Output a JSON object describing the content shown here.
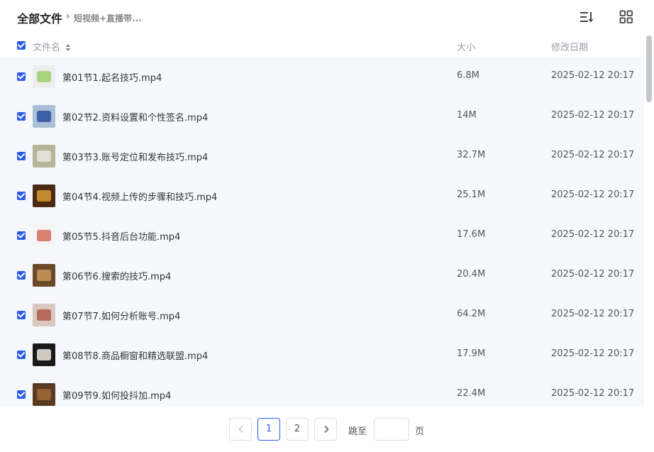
{
  "header": {
    "title": "全部文件",
    "breadcrumb": "短视频+直播带..."
  },
  "columns": {
    "name": "文件名",
    "size": "大小",
    "date": "修改日期"
  },
  "files": [
    {
      "name": "第01节1.起名技巧.mp4",
      "size": "6.8M",
      "date": "2025-02-12 20:17",
      "thumb_a": "#eeeeee",
      "thumb_b": "#9ccf6a"
    },
    {
      "name": "第02节2.资料设置和个性签名.mp4",
      "size": "14M",
      "date": "2025-02-12 20:17",
      "thumb_a": "#a9bfd6",
      "thumb_b": "#2d4f9e"
    },
    {
      "name": "第03节3.账号定位和发布技巧.mp4",
      "size": "32.7M",
      "date": "2025-02-12 20:17",
      "thumb_a": "#b8b49a",
      "thumb_b": "#e8e6de"
    },
    {
      "name": "第04节4.视频上传的步骤和技巧.mp4",
      "size": "25.1M",
      "date": "2025-02-12 20:17",
      "thumb_a": "#4a2a10",
      "thumb_b": "#d89a3a"
    },
    {
      "name": "第05节5.抖音后台功能.mp4",
      "size": "17.6M",
      "date": "2025-02-12 20:17",
      "thumb_a": "#f4f4f4",
      "thumb_b": "#d66a5a"
    },
    {
      "name": "第06节6.搜索的技巧.mp4",
      "size": "20.4M",
      "date": "2025-02-12 20:17",
      "thumb_a": "#6a4a2a",
      "thumb_b": "#c89a5a"
    },
    {
      "name": "第07节7.如何分析账号.mp4",
      "size": "64.2M",
      "date": "2025-02-12 20:17",
      "thumb_a": "#d8c8c0",
      "thumb_b": "#b05a4a"
    },
    {
      "name": "第08节8.商品橱窗和精选联盟.mp4",
      "size": "17.9M",
      "date": "2025-02-12 20:17",
      "thumb_a": "#1a1a1a",
      "thumb_b": "#f2e8e0"
    },
    {
      "name": "第09节9.如何投抖加.mp4",
      "size": "22.4M",
      "date": "2025-02-12 20:17",
      "thumb_a": "#5a3a20",
      "thumb_b": "#a06a3a"
    }
  ],
  "pagination": {
    "pages": [
      "1",
      "2"
    ],
    "current": "1",
    "jump_label": "跳至",
    "jump_value": "",
    "page_unit": "页"
  },
  "colors": {
    "accent": "#2d5bea",
    "row_bg": "#f6f8fd"
  },
  "icons": [
    "sort-list-icon",
    "grid-view-icon",
    "sort-arrows-icon",
    "checkbox-icon",
    "chevron-left-icon",
    "chevron-right-icon"
  ]
}
